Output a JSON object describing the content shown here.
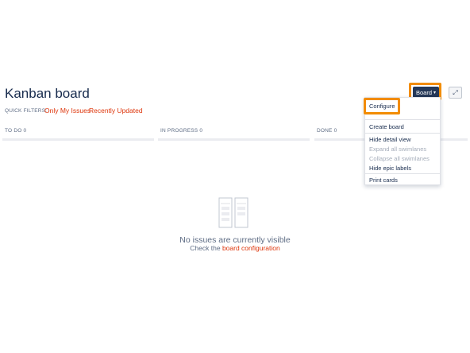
{
  "header": {
    "title": "Kanban board"
  },
  "quick_filters": {
    "label": "QUICK FILTERS:",
    "items": [
      "Only My Issues",
      "Recently Updated"
    ]
  },
  "toolbar": {
    "board_label": "Board",
    "board_chevron": "▾",
    "expand_icon": "⤢"
  },
  "columns": [
    {
      "name": "TO DO",
      "count": "0"
    },
    {
      "name": "IN PROGRESS",
      "count": "0"
    },
    {
      "name": "DONE",
      "count": "0"
    }
  ],
  "board_menu": {
    "configure": "Configure",
    "create_board": "Create board",
    "hide_detail_view": "Hide detail view",
    "expand_all_swimlanes": "Expand all swimlanes",
    "collapse_all_swimlanes": "Collapse all swimlanes",
    "hide_epic_labels": "Hide epic labels",
    "print_cards": "Print cards"
  },
  "empty_state": {
    "message": "No issues are currently visible",
    "hint_prefix": "Check the",
    "hint_link": "board configuration"
  },
  "colors": {
    "accent": "#de350b",
    "board_button": "#253858",
    "highlight": "#f28c00",
    "text": "#172b4d",
    "muted": "#5e6c84"
  }
}
